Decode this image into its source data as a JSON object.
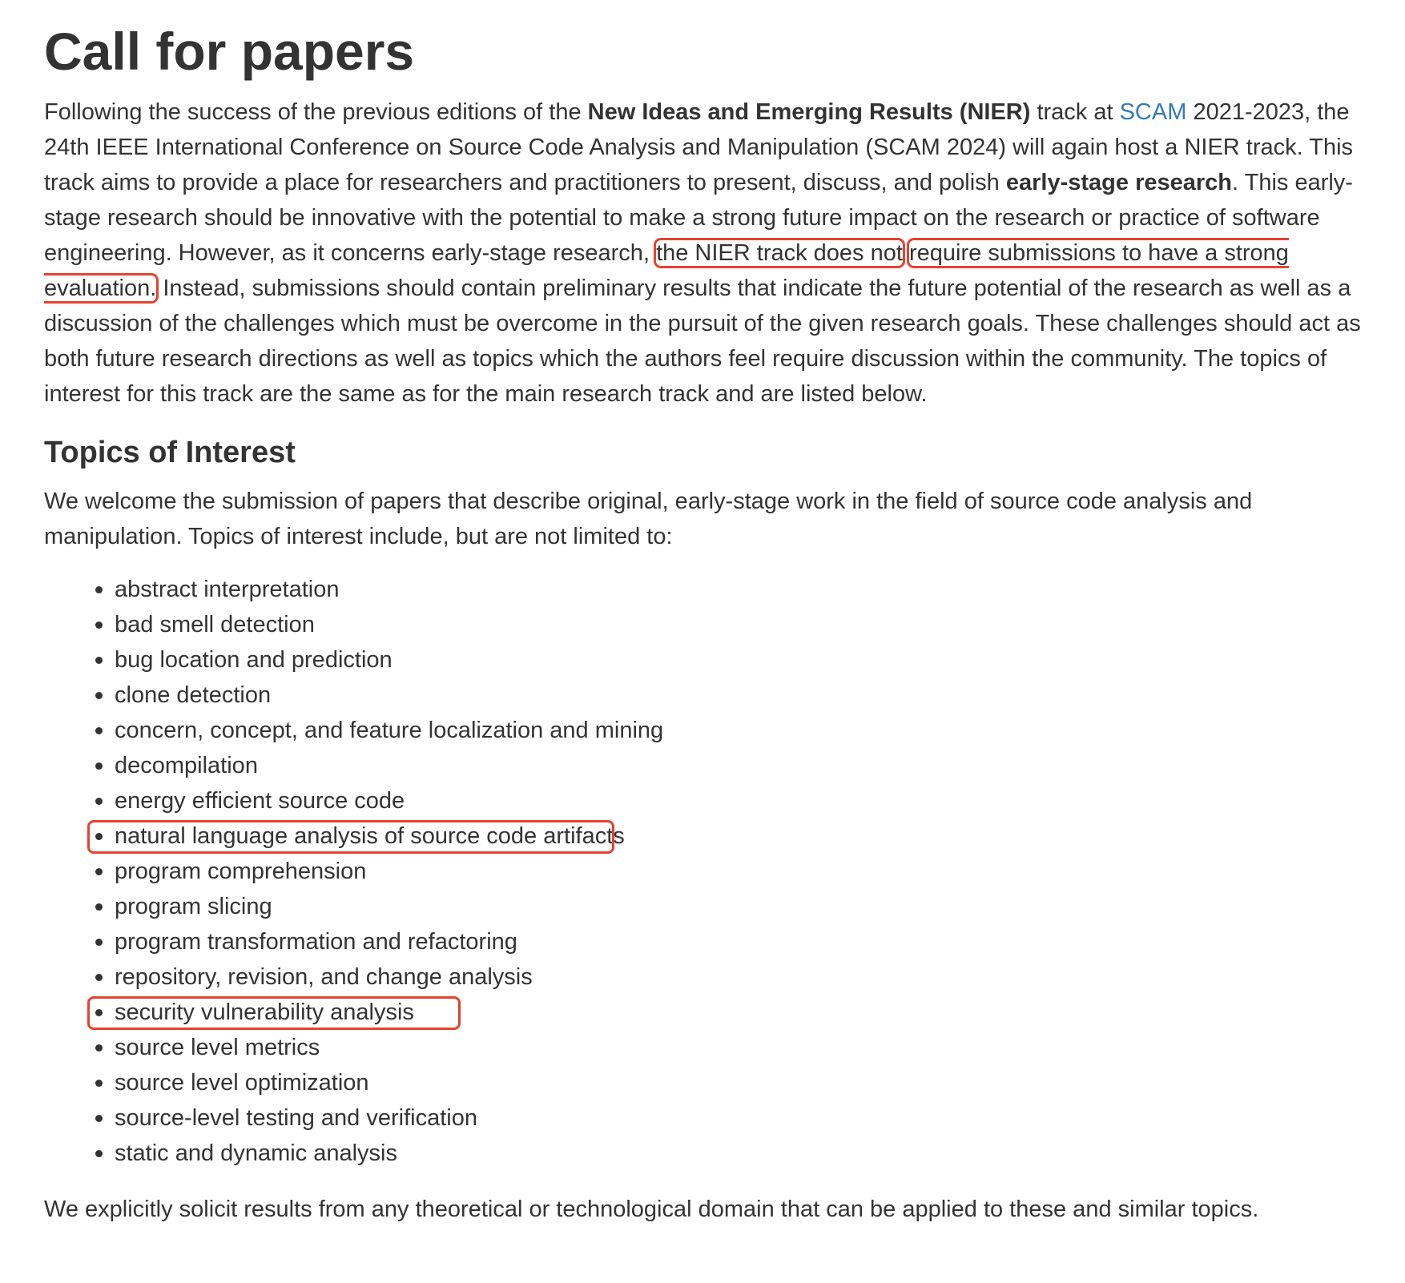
{
  "title": "Call for papers",
  "intro": {
    "t1": "Following the success of the previous editions of the ",
    "bold1": "New Ideas and Emerging Results (NIER)",
    "t2": " track at ",
    "link_text": "SCAM",
    "t3": " 2021-2023, the 24th IEEE International Conference on Source Code Analysis and Manipulation (SCAM 2024) will again host a NIER track. This track aims to provide a place for researchers and practitioners to present, discuss, and polish ",
    "bold2": "early-stage research",
    "t4": ". This early-stage research should be innovative with the potential to make a strong future impact on the research or practice of software engineering. However, as it concerns early-stage research, ",
    "highlight_a": "the NIER track does not",
    "highlight_b": "require submissions to have a strong evaluation.",
    "t5": " Instead, submissions should contain preliminary results that indicate the future potential of the research as well as a discussion of the challenges which must be overcome in the pursuit of the given research goals. These challenges should act as both future research directions as well as topics which the authors feel require discussion within the community. The topics of interest for this track are the same as for the main research track and are listed below."
  },
  "topics_heading": "Topics of Interest",
  "welcome": "We welcome the submission of papers that describe original, early-stage work in the field of source code analysis and manipulation. Topics of interest include, but are not limited to:",
  "topics": [
    "abstract interpretation",
    "bad smell detection",
    "bug location and prediction",
    "clone detection",
    "concern, concept, and feature localization and mining",
    "decompilation",
    "energy efficient source code",
    "natural language analysis of source code artifacts",
    "program comprehension",
    "program slicing",
    "program transformation and refactoring",
    "repository, revision, and change analysis",
    "security vulnerability analysis",
    "source level metrics",
    "source level optimization",
    "source-level testing and verification",
    "static and dynamic analysis"
  ],
  "highlighted_topics": [
    "natural language analysis of source code artifacts",
    "security vulnerability analysis"
  ],
  "outro": "We explicitly solicit results from any theoretical or technological domain that can be applied to these and similar topics.",
  "colors": {
    "text": "#333333",
    "link": "#337ab7",
    "highlight_box": "#e8412f"
  }
}
